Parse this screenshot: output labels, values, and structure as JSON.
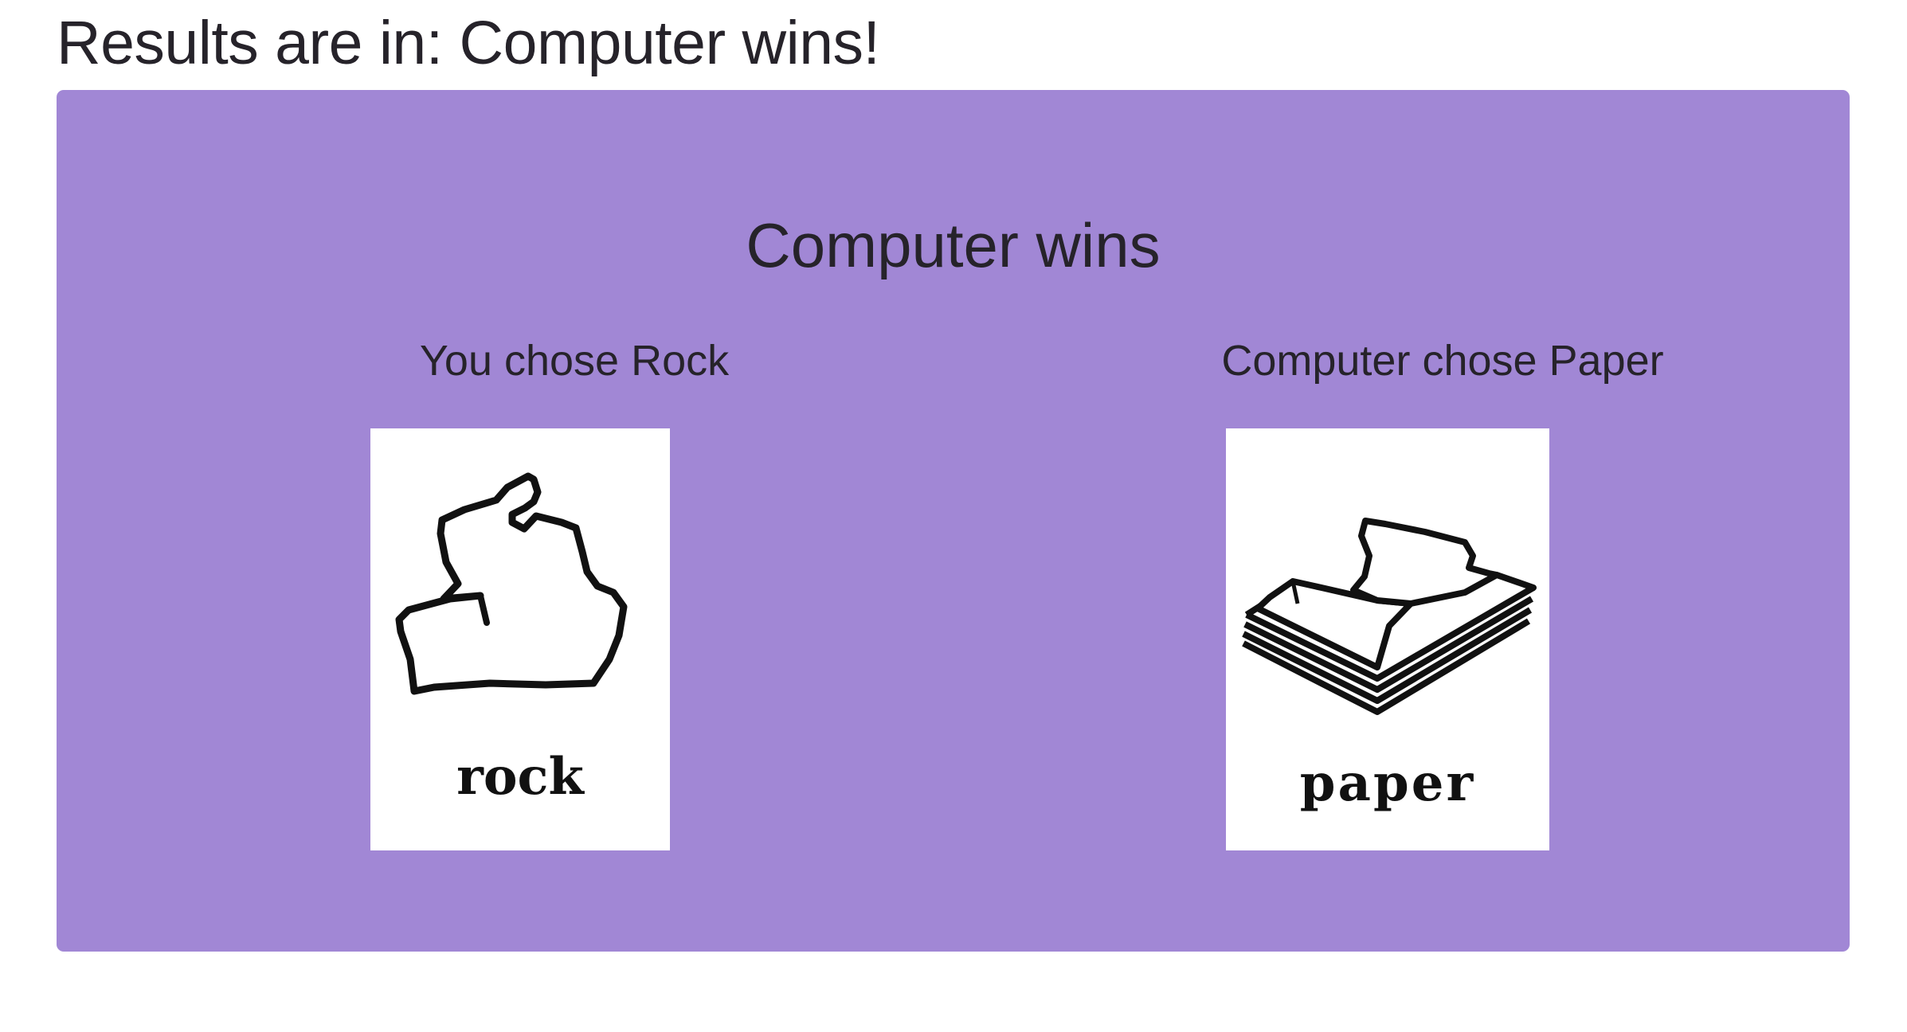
{
  "page": {
    "title": "Results are in: Computer wins!"
  },
  "result": {
    "heading": "Computer wins",
    "panel_color": "#a187d5"
  },
  "player": {
    "label": "You chose Rock",
    "choice_icon": "rock-icon",
    "card_word": "rock"
  },
  "computer": {
    "label": "Computer chose Paper",
    "choice_icon": "paper-icon",
    "card_word": "paper"
  }
}
